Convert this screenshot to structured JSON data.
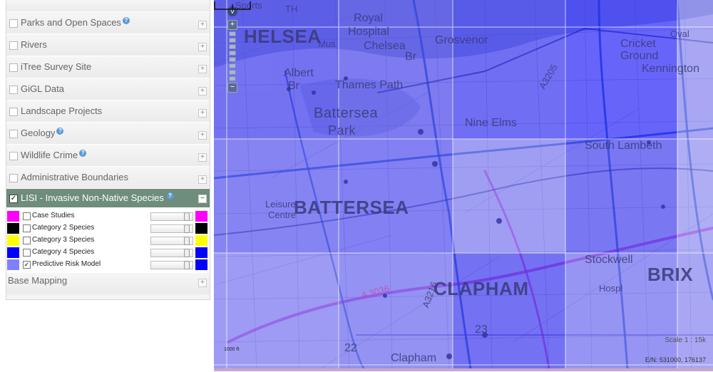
{
  "panel": {
    "layers": [
      {
        "label": "Parks and Open Spaces",
        "info": true
      },
      {
        "label": "Rivers",
        "info": false
      },
      {
        "label": "iTree Survey Site",
        "info": false
      },
      {
        "label": "GiGL Data",
        "info": false
      },
      {
        "label": "Landscape Projects",
        "info": false
      },
      {
        "label": "Geology",
        "info": true
      },
      {
        "label": "Wildlife Crime",
        "info": true
      },
      {
        "label": "Administrative Boundaries",
        "info": false
      }
    ],
    "active_group": {
      "label": "LISI - Invasive Non-Native Species",
      "checked": true,
      "info": true
    },
    "legend": [
      {
        "label": "Case Studies",
        "color": "#ff00ff",
        "checked": false,
        "opacity": 1.0
      },
      {
        "label": "Category 2 Species",
        "color": "#000000",
        "checked": false,
        "opacity": 1.0
      },
      {
        "label": "Category 3 Species",
        "color": "#ffff00",
        "checked": false,
        "opacity": 1.0
      },
      {
        "label": "Category 4 Species",
        "color": "#0000ff",
        "checked": false,
        "opacity": 1.0
      },
      {
        "label": "Predictive Risk Model",
        "color": "#8080ff",
        "checked": true,
        "opacity": 1.0
      }
    ],
    "legend_right_colors": [
      "#ff00ff",
      "#000000",
      "#ffff00",
      "#0000ff",
      "#0000ff"
    ],
    "base_mapping": "Base Mapping",
    "plus_symbol": "+",
    "minus_symbol": "−",
    "check_symbol": "✓",
    "info_symbol": "?"
  },
  "map": {
    "places": {
      "chelsea": "HELSEA",
      "royal": "Royal",
      "hospital": "Hospital",
      "chelsea_br": "Chelsea",
      "br": "Br",
      "grosvenor": "Grosvenor",
      "albert": "Albert",
      "albert_br": "Br",
      "thames_path": "Thames Path",
      "battersea_park": "Battersea",
      "park": "Park",
      "nine_elms": "Nine Elms",
      "cricket": "Cricket",
      "ground": "Ground",
      "kennington": "Kennington",
      "south_lambeth": "South Lambeth",
      "battersea": "BATTERSEA",
      "leisure": "Leisure",
      "centre": "Centre",
      "clapham": "CLAPHAM",
      "stockwell": "Stockwell",
      "hospl": "Hospl",
      "brix": "BRIX",
      "clapham_small": "Clapham",
      "a3036": "A 3036",
      "a3216": "A3216",
      "a3205": "A3205",
      "road22": "22",
      "road23": "23",
      "oval": "Oval",
      "musm": "Mus",
      "th": "TH",
      "sports": "Sports"
    },
    "scale_label": "1000 ft",
    "scale_text": "Scale 1 : 15k",
    "coords": "E/N: 531000, 176137",
    "zoom_plus": "+",
    "zoom_minus": "−",
    "v_button": "V",
    "colors": {
      "overlay": "#3333ff",
      "road_pink": "#d04cd0",
      "road_blue": "#3a64c8"
    }
  }
}
